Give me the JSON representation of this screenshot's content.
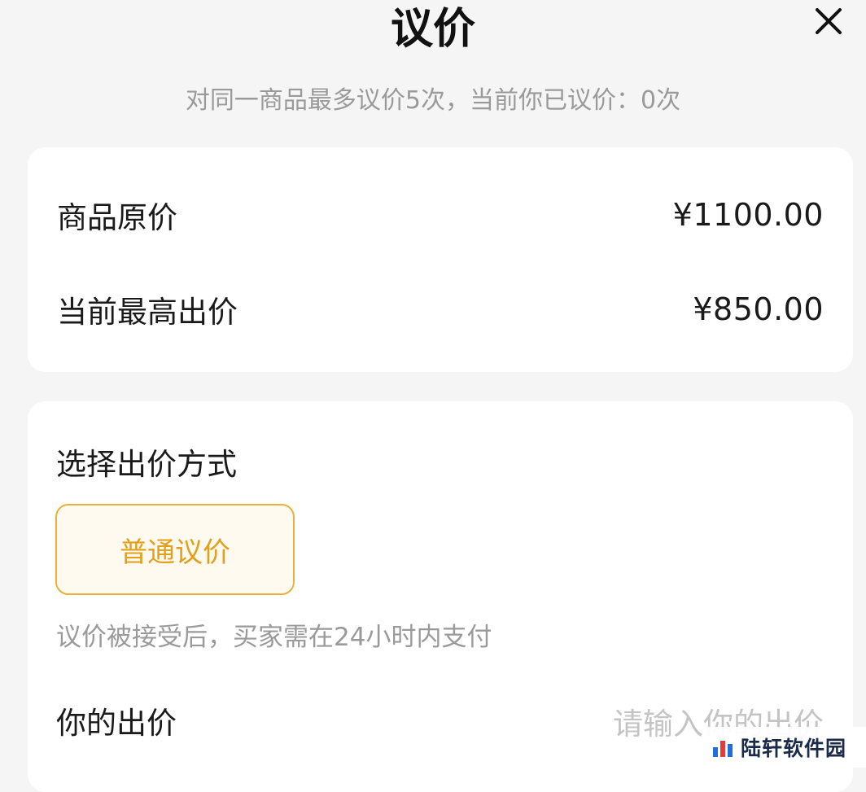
{
  "header": {
    "title": "议价",
    "close_icon": "close-icon"
  },
  "subtitle": "对同一商品最多议价5次，当前你已议价：0次",
  "price_info": {
    "original_label": "商品原价",
    "original_value": "¥1100.00",
    "highest_label": "当前最高出价",
    "highest_value": "¥850.00"
  },
  "bid_method": {
    "title": "选择出价方式",
    "option_label": "普通议价",
    "hint": "议价被接受后，买家需在24小时内支付"
  },
  "your_bid": {
    "label": "你的出价",
    "placeholder": "请输入你的出价",
    "value": ""
  },
  "watermark": {
    "text": "陆轩软件园"
  },
  "colors": {
    "accent": "#e39e1a",
    "accent_border": "#e8b23a",
    "accent_bg": "#fffaf0",
    "background": "#f5f5f5",
    "card": "#ffffff",
    "muted_text": "#9a9a9a"
  }
}
